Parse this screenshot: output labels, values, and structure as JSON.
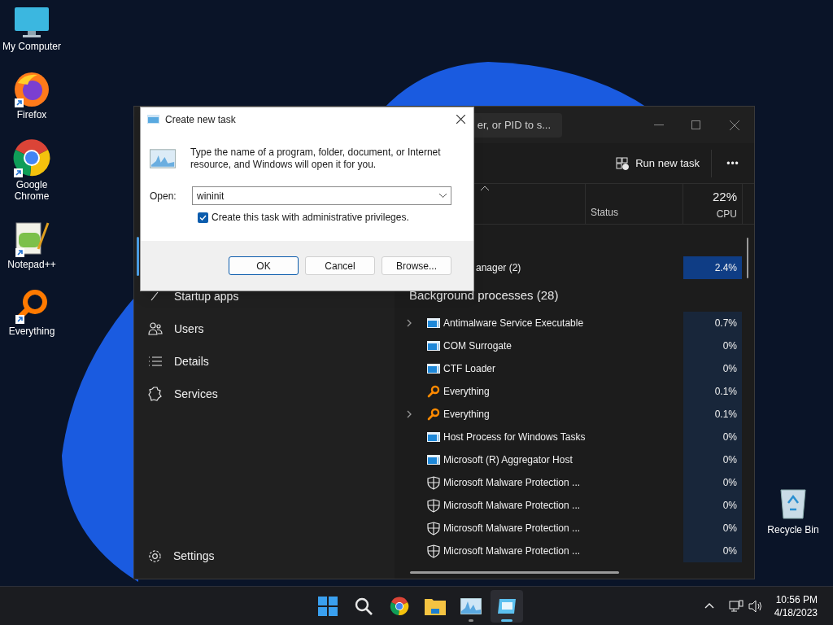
{
  "desktop_icons": [
    {
      "label": "My Computer",
      "kind": "computer",
      "shortcut": false
    },
    {
      "label": "Firefox",
      "kind": "firefox",
      "shortcut": true
    },
    {
      "label": "Google Chrome",
      "kind": "chrome",
      "shortcut": true
    },
    {
      "label": "Notepad++",
      "kind": "notepad",
      "shortcut": true
    },
    {
      "label": "Everything",
      "kind": "everything",
      "shortcut": true
    }
  ],
  "recycle_bin": {
    "label": "Recycle Bin"
  },
  "task_manager": {
    "search": {
      "placeholder": "er, or PID to s..."
    },
    "nav": [
      {
        "label": "Startup apps",
        "kind": "startup"
      },
      {
        "label": "Users",
        "kind": "users"
      },
      {
        "label": "Details",
        "kind": "details"
      },
      {
        "label": "Services",
        "kind": "services"
      }
    ],
    "settings": "Settings",
    "run_new_task": "Run new task",
    "more": "•••",
    "columns": {
      "status": "Status",
      "cpu_total": "22%",
      "cpu": "CPU"
    },
    "app_rows": [
      {
        "name": "anager (2)",
        "cpu": "2.4%",
        "highlight": true
      }
    ],
    "group": "Background processes (28)",
    "processes": [
      {
        "name": "Antimalware Service Executable",
        "cpu": "0.7%",
        "kind": "window",
        "expandable": true
      },
      {
        "name": "COM Surrogate",
        "cpu": "0%",
        "kind": "window",
        "expandable": false
      },
      {
        "name": "CTF Loader",
        "cpu": "0%",
        "kind": "window",
        "expandable": false
      },
      {
        "name": "Everything",
        "cpu": "0.1%",
        "kind": "everything",
        "expandable": false
      },
      {
        "name": "Everything",
        "cpu": "0.1%",
        "kind": "everything",
        "expandable": true
      },
      {
        "name": "Host Process for Windows Tasks",
        "cpu": "0%",
        "kind": "window",
        "expandable": false
      },
      {
        "name": "Microsoft (R) Aggregator Host",
        "cpu": "0%",
        "kind": "window",
        "expandable": false
      },
      {
        "name": "Microsoft Malware Protection ...",
        "cpu": "0%",
        "kind": "shield",
        "expandable": false
      },
      {
        "name": "Microsoft Malware Protection ...",
        "cpu": "0%",
        "kind": "shield",
        "expandable": false
      },
      {
        "name": "Microsoft Malware Protection ...",
        "cpu": "0%",
        "kind": "shield",
        "expandable": false
      },
      {
        "name": "Microsoft Malware Protection ...",
        "cpu": "0%",
        "kind": "shield",
        "expandable": false
      }
    ]
  },
  "dialog": {
    "title": "Create new task",
    "description": "Type the name of a program, folder, document, or Internet resource, and Windows will open it for you.",
    "open_label": "Open:",
    "value": "wininit",
    "checkbox": {
      "label": "Create this task with administrative privileges.",
      "checked": true
    },
    "buttons": [
      {
        "label": "OK",
        "default": true
      },
      {
        "label": "Cancel",
        "default": false
      },
      {
        "label": "Browse...",
        "default": false
      }
    ]
  },
  "taskbar": {
    "items": [
      {
        "kind": "start",
        "running": false,
        "selected": false
      },
      {
        "kind": "search",
        "running": false,
        "selected": false
      },
      {
        "kind": "chrome",
        "running": false,
        "selected": false
      },
      {
        "kind": "folder",
        "running": false,
        "selected": false
      },
      {
        "kind": "taskmgr",
        "running": true,
        "selected": false
      },
      {
        "kind": "runtask",
        "running": true,
        "selected": true
      }
    ],
    "time": "10:56 PM",
    "date": "4/18/2023"
  }
}
